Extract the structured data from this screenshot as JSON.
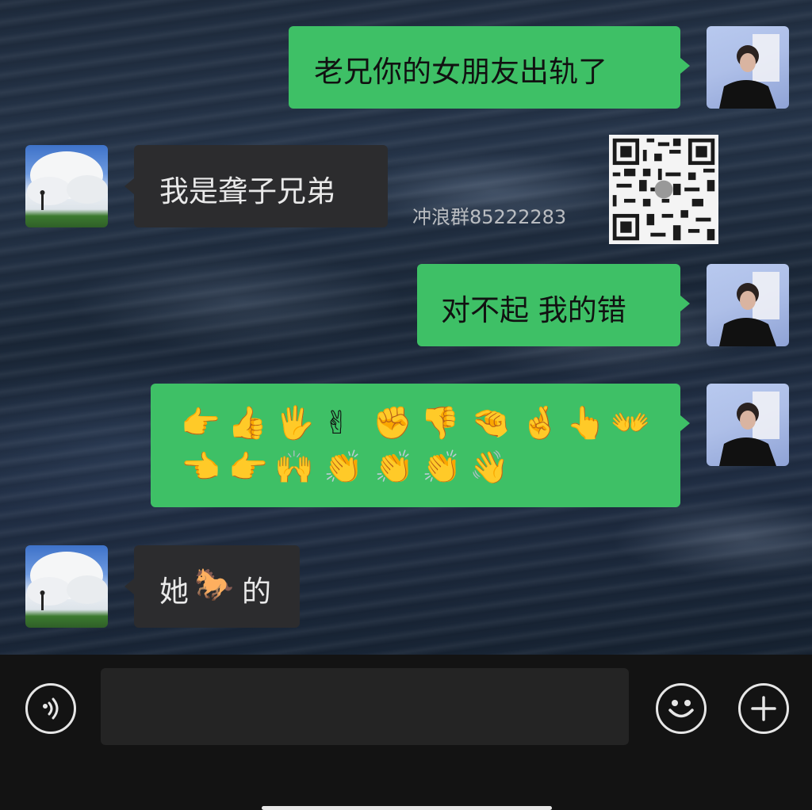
{
  "messages": [
    {
      "side": "right",
      "text": "老兄你的女朋友出轨了"
    },
    {
      "side": "left",
      "text": "我是聋子兄弟"
    },
    {
      "side": "right",
      "text": "对不起 我的错"
    },
    {
      "side": "right",
      "emoji_rows": [
        [
          "👉",
          "👍",
          "🖐",
          "✌",
          "✊",
          "👎",
          "🤏",
          "🤞",
          "👆",
          "👐"
        ],
        [
          "👈",
          "👉",
          "🙌",
          "👏",
          "👏",
          "👏",
          "👋"
        ]
      ]
    },
    {
      "side": "left",
      "text_before": "她",
      "emoji": "🐎",
      "text_after": "的"
    }
  ],
  "watermark": "冲浪群85222283",
  "input_bar": {
    "voice_icon": "voice-icon",
    "emoji_icon": "smiley-icon",
    "add_icon": "plus-icon"
  },
  "colors": {
    "self_bubble": "#3ec066",
    "friend_bubble": "#2c2c2e",
    "bar": "#131313"
  }
}
